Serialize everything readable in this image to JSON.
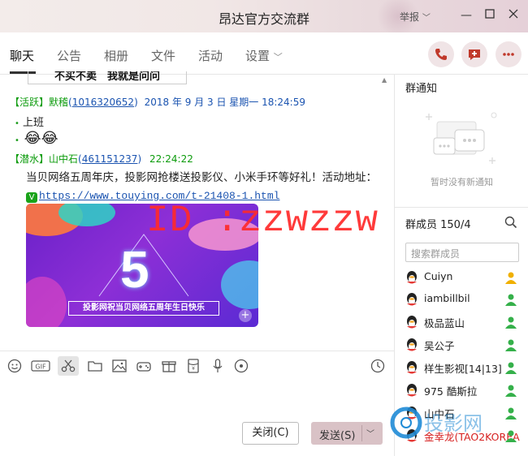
{
  "window": {
    "title": "昂达官方交流群",
    "report_label": "举报",
    "controls": [
      "minimize",
      "maximize",
      "close"
    ]
  },
  "tabs": [
    {
      "label": "聊天",
      "active": true
    },
    {
      "label": "公告"
    },
    {
      "label": "相册"
    },
    {
      "label": "文件"
    },
    {
      "label": "活动"
    },
    {
      "label": "设置"
    }
  ],
  "chat": {
    "cropped_button_text": "不买不卖　我就是问问",
    "messages": [
      {
        "badge": "【活跃】",
        "name": "默稽",
        "qq": "1016320652",
        "time": "2018 年 9 月 3 日 星期一 18:24:59",
        "lines": [
          "上班",
          "😂😂"
        ]
      },
      {
        "badge": "【潜水】",
        "name": "山中石",
        "qq": "461151237",
        "time": "22:24:22",
        "text": "当贝网络五周年庆，投影网抢楼送投影仪、小米手环等好礼！活动地址：",
        "link": "https://www.touying.com/t-21408-1.html",
        "image": {
          "number": "5",
          "caption": "投影网祝当贝网络五周年生日快乐"
        }
      }
    ],
    "overlay_id": "ID :zzwzzw"
  },
  "toolbar": {
    "tools": [
      "smiley-icon",
      "gif-icon",
      "scissors-icon",
      "folder-icon",
      "image-icon",
      "gamepad-icon",
      "gift-icon",
      "red-packet-icon",
      "microphone-icon",
      "clock-icon"
    ],
    "gif_label": "GIF",
    "close_label": "关闭(C)",
    "send_label": "发送(S)"
  },
  "sidebar": {
    "notice_title": "群通知",
    "notice_empty": "暂时没有新通知",
    "members_title": "群成员 150/4",
    "search_placeholder": "搜索群成员",
    "members": [
      {
        "name": "Cuiyn",
        "role": "owner"
      },
      {
        "name": "iambillbil",
        "role": "member"
      },
      {
        "name": "极品蓝山",
        "role": "member"
      },
      {
        "name": "吴公子",
        "role": "member"
      },
      {
        "name": "样生影视[14|13]",
        "role": "member"
      },
      {
        "name": "975 酷斯拉",
        "role": "member"
      },
      {
        "name": "山中石",
        "role": "member"
      },
      {
        "name": "金幸龙(TAO2KOREA",
        "role": "member"
      }
    ],
    "watermark_text": "投影网"
  },
  "colors": {
    "accent": "#c0392b",
    "pink_btn": "#f0e4e6",
    "send_btn": "#d9c2c6",
    "green_badge": "#0b9b0b",
    "link_blue": "#1a53b0",
    "watermark_red": "#ff2a2a"
  }
}
